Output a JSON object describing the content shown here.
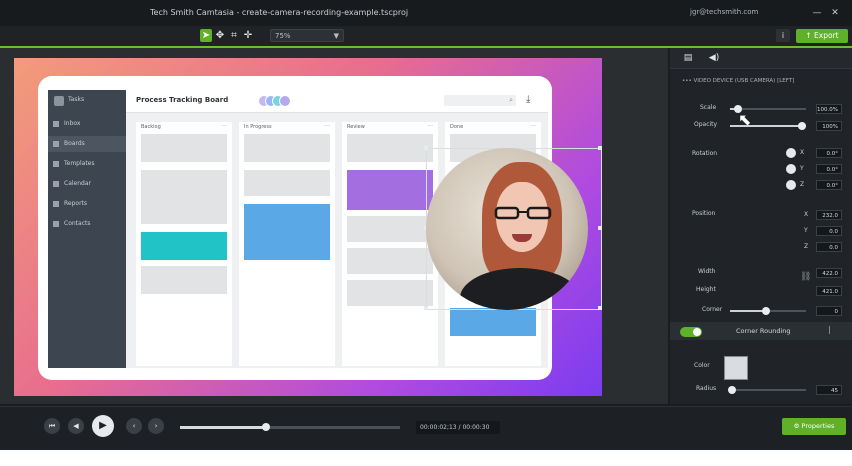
{
  "window": {
    "title": "Tech Smith Camtasia - create-camera-recording-example.tscproj",
    "account": "jgr@techsmith.com",
    "minimize_label": "—",
    "close_label": "✕"
  },
  "toolbar": {
    "zoom_value": "75%",
    "info_label": "i",
    "export_label": "↑ Export"
  },
  "canvas": {
    "app": {
      "logo_text": "Tasks",
      "board_title": "Process Tracking Board",
      "nav": [
        {
          "label": "Inbox",
          "active": false
        },
        {
          "label": "Boards",
          "active": true
        },
        {
          "label": "Templates",
          "active": false
        },
        {
          "label": "Calendar",
          "active": false
        },
        {
          "label": "Reports",
          "active": false
        },
        {
          "label": "Contacts",
          "active": false
        }
      ],
      "avatars": [
        "#c7b6f2",
        "#9ab8f0",
        "#7ad3e3",
        "#b4a8f0"
      ],
      "columns": [
        {
          "title": "Backlog"
        },
        {
          "title": "In Progress"
        },
        {
          "title": "Review"
        },
        {
          "title": "Done"
        }
      ]
    }
  },
  "panel": {
    "breadcrumb": "••• VIDEO DEVICE (USB CAMERA) [LEFT]",
    "scale_label": "Scale",
    "scale_value": "100.0%",
    "opacity_label": "Opacity",
    "opacity_value": "100%",
    "rotation_label": "Rotation",
    "position_label": "Position",
    "width_label": "Width",
    "height_label": "Height",
    "corner_label": "Corner",
    "rotation": {
      "x": "0.0°",
      "y": "0.0°",
      "z": "0.0°"
    },
    "position": {
      "x": "232.0",
      "y": "0.0",
      "z": "0.0"
    },
    "width_value": "422.0",
    "height_value": "421.0",
    "corner_value": "0",
    "axis_x": "X",
    "axis_y": "Y",
    "axis_z": "Z",
    "section_title": "Corner Rounding",
    "color_label": "Color",
    "radius_label": "Radius",
    "radius_value": "45"
  },
  "playback": {
    "timecode": "00:00:02;13 / 00:00:30",
    "properties_label": "⚙ Properties",
    "progress": 0.39
  },
  "icons": {
    "tools": [
      "arrow-tool-icon",
      "hand-tool-icon",
      "crop-tool-icon",
      "pan-tool-icon"
    ],
    "panel_tabs": [
      "visual-properties-icon",
      "audio-properties-icon"
    ]
  }
}
